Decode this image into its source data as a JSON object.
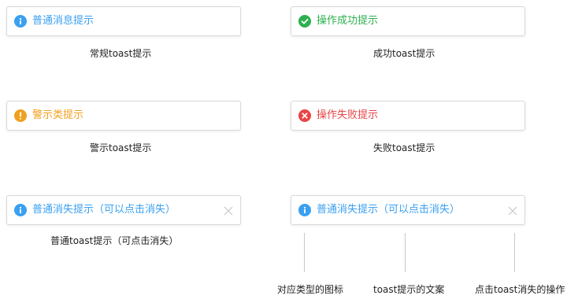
{
  "colors": {
    "info": "#3aa0f0",
    "success": "#2db04f",
    "warning": "#f0a020",
    "error": "#e84545"
  },
  "toasts": [
    {
      "message": "普通消息提示",
      "caption": "常规toast提示",
      "icon": "info-icon"
    },
    {
      "message": "操作成功提示",
      "caption": "成功toast提示",
      "icon": "check-icon"
    },
    {
      "message": "警示类提示",
      "caption": "警示toast提示",
      "icon": "warning-icon"
    },
    {
      "message": "操作失败提示",
      "caption": "失败toast提示",
      "icon": "error-icon"
    },
    {
      "message": "普通消失提示（可以点击消失）",
      "caption": "普通toast提示（可点击消失）",
      "icon": "info-icon",
      "closable": true
    },
    {
      "message": "普通消失提示（可以点击消失）",
      "icon": "info-icon",
      "closable": true
    }
  ],
  "annotations": {
    "icon": "对应类型的图标",
    "text": "toast提示的文案",
    "close": "点击toast消失的操作"
  }
}
